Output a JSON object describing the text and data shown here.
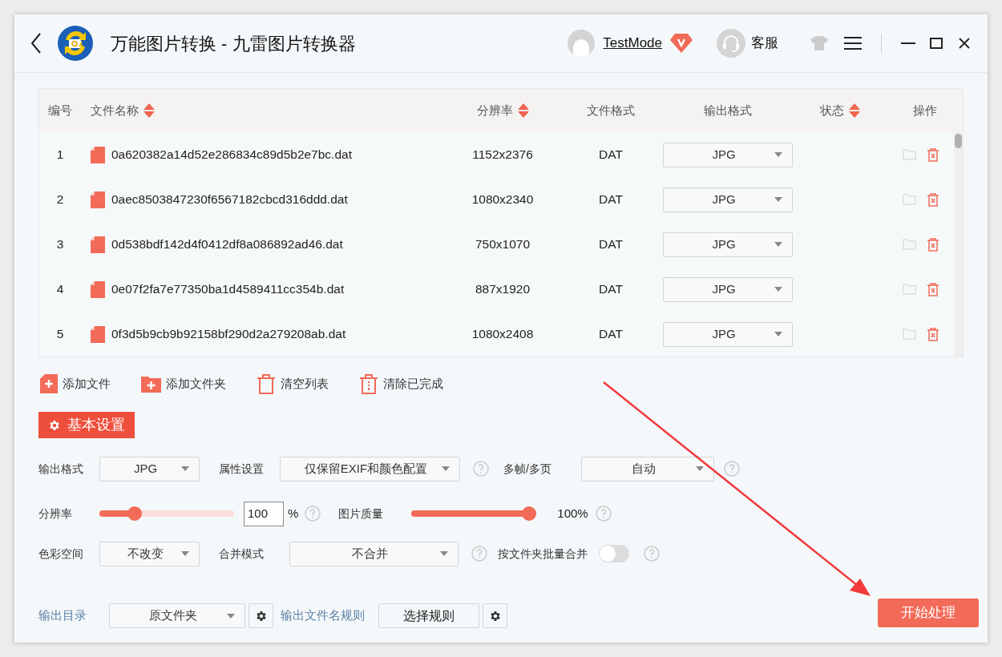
{
  "window": {
    "title": "万能图片转换 - 九雷图片转换器"
  },
  "header": {
    "user": "TestMode",
    "support": "客服"
  },
  "table": {
    "columns": [
      {
        "label": "编号",
        "sortable": false
      },
      {
        "label": "文件名称",
        "sortable": true
      },
      {
        "label": "分辨率",
        "sortable": true
      },
      {
        "label": "文件格式",
        "sortable": false
      },
      {
        "label": "输出格式",
        "sortable": false
      },
      {
        "label": "状态",
        "sortable": true
      },
      {
        "label": "操作",
        "sortable": false
      }
    ],
    "rows": [
      {
        "index": "1",
        "name": "0a620382a14d52e286834c89d5b2e7bc.dat",
        "resolution": "1152x2376",
        "format": "DAT",
        "output": "JPG"
      },
      {
        "index": "2",
        "name": "0aec8503847230f6567182cbcd316ddd.dat",
        "resolution": "1080x2340",
        "format": "DAT",
        "output": "JPG"
      },
      {
        "index": "3",
        "name": "0d538bdf142d4f0412df8a086892ad46.dat",
        "resolution": "750x1070",
        "format": "DAT",
        "output": "JPG"
      },
      {
        "index": "4",
        "name": "0e07f2fa7e77350ba1d4589411cc354b.dat",
        "resolution": "887x1920",
        "format": "DAT",
        "output": "JPG"
      },
      {
        "index": "5",
        "name": "0f3d5b9cb9b92158bf290d2a279208ab.dat",
        "resolution": "1080x2408",
        "format": "DAT",
        "output": "JPG"
      }
    ]
  },
  "toolbar": [
    {
      "kind": "add-file",
      "label": "添加文件"
    },
    {
      "kind": "add-folder",
      "label": "添加文件夹"
    },
    {
      "kind": "clear",
      "label": "清空列表"
    },
    {
      "kind": "clear-done",
      "label": "清除已完成"
    }
  ],
  "settings": {
    "title": "基本设置",
    "output_format": {
      "label": "输出格式",
      "value": "JPG"
    },
    "attributes": {
      "label": "属性设置",
      "value": "仅保留EXIF和颜色配置"
    },
    "multi_frame": {
      "label": "多帧/多页",
      "value": "自动"
    },
    "resolution": {
      "label": "分辨率",
      "level": 0.23,
      "value": "100",
      "unit": "%"
    },
    "quality": {
      "label": "图片质量",
      "level": 1,
      "reading": "100%"
    },
    "color_space": {
      "label": "色彩空间",
      "value": "不改变"
    },
    "merge_mode": {
      "label": "合并模式",
      "value": "不合并"
    },
    "merge_by_folder": {
      "label": "按文件夹批量合并",
      "on": false
    }
  },
  "output": {
    "dir_label": "输出目录",
    "dir_value": "原文件夹",
    "rule_label": "输出文件名规则",
    "rule_button": "选择规则"
  },
  "start_button": "开始处理"
}
